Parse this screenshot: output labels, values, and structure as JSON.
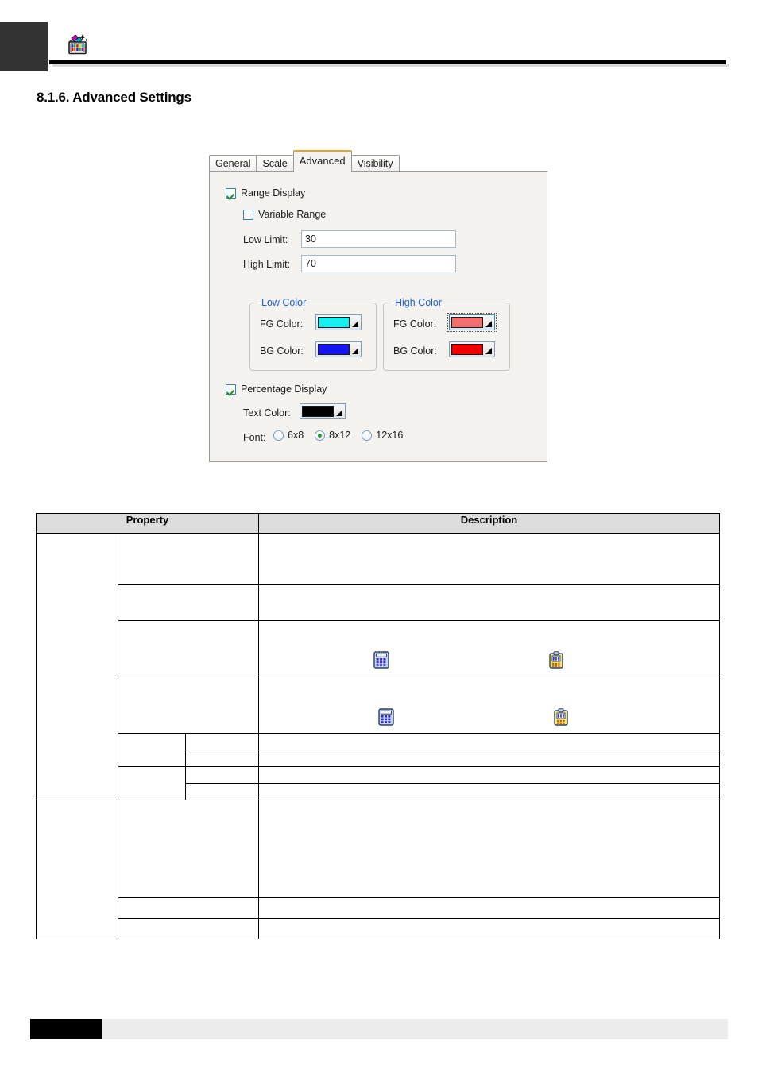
{
  "header": {
    "logo_icon": "paint-palette-grid-icon"
  },
  "section": {
    "title": "8.1.6. Advanced Settings"
  },
  "dialog": {
    "tabs": [
      {
        "label": "General",
        "selected": false
      },
      {
        "label": "Scale",
        "selected": false
      },
      {
        "label": "Advanced",
        "selected": true
      },
      {
        "label": "Visibility",
        "selected": false
      }
    ],
    "selected_tab_accent": "#f0a020",
    "range_display": {
      "label": "Range Display",
      "checked": true
    },
    "variable_range": {
      "label": "Variable Range",
      "checked": false
    },
    "low_limit": {
      "label": "Low Limit:",
      "value": "30"
    },
    "high_limit": {
      "label": "High Limit:",
      "value": "70"
    },
    "low_color_group": {
      "title": "Low Color",
      "fg_label": "FG Color:",
      "fg_color": "#18f0f0",
      "bg_label": "BG Color:",
      "bg_color": "#1414f0"
    },
    "high_color_group": {
      "title": "High Color",
      "fg_label": "FG Color:",
      "fg_color": "#f07070",
      "bg_label": "BG Color:",
      "bg_color": "#f00000"
    },
    "percentage_display": {
      "label": "Percentage Display",
      "checked": true
    },
    "text_color": {
      "label": "Text Color:",
      "color": "#000000"
    },
    "font": {
      "label": "Font:",
      "options": [
        {
          "label": "6x8",
          "selected": false
        },
        {
          "label": "8x12",
          "selected": true
        },
        {
          "label": "12x16",
          "selected": false
        }
      ]
    }
  },
  "table": {
    "headers": [
      "Property",
      "Description"
    ],
    "rows": [
      {
        "c1": "",
        "c2": "",
        "c3": "",
        "desc": ""
      },
      {
        "c1": "",
        "c2": "",
        "c3": "",
        "desc": ""
      },
      {
        "c1": "",
        "c2": "",
        "c3": "",
        "desc": ""
      },
      {
        "c1": "",
        "c2": "",
        "c3": "",
        "desc": ""
      },
      {
        "c1": "",
        "c2": "",
        "c3": "",
        "desc": ""
      },
      {
        "c1": "",
        "c2": "",
        "c3": "",
        "desc": ""
      },
      {
        "c1": "",
        "c2": "",
        "c3": "",
        "desc": ""
      },
      {
        "c1": "",
        "c2": "",
        "c3": "",
        "desc": ""
      },
      {
        "c1": "",
        "c2": "",
        "c3": "",
        "desc": ""
      },
      {
        "c1": "",
        "c2": "",
        "c3": "",
        "desc": ""
      },
      {
        "c1": "",
        "c2": "",
        "c3": "",
        "desc": ""
      }
    ],
    "icons": {
      "calculator": "calculator-keypad-icon",
      "token": "token-keypad-icon"
    }
  },
  "footer": {
    "black_bar": "",
    "gray_bar": ""
  }
}
